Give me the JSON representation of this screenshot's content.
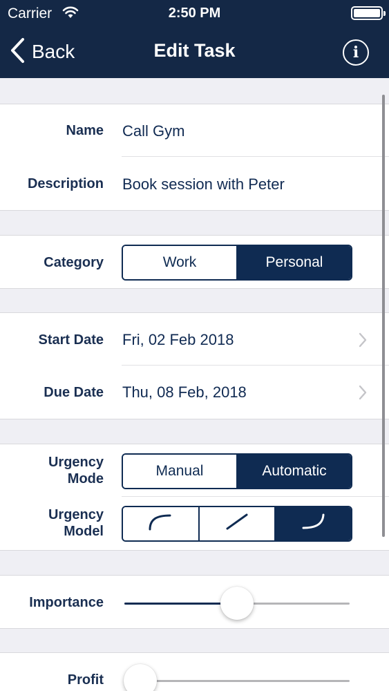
{
  "status_bar": {
    "carrier": "Carrier",
    "time": "2:50 PM"
  },
  "nav": {
    "back_label": "Back",
    "title": "Edit Task",
    "info_glyph": "i"
  },
  "task": {
    "name_label": "Name",
    "name_value": "Call Gym",
    "description_label": "Description",
    "description_value": "Book session with Peter"
  },
  "category": {
    "label": "Category",
    "options": [
      "Work",
      "Personal"
    ],
    "selected": "Personal"
  },
  "dates": {
    "start_label": "Start Date",
    "start_value": "Fri, 02 Feb 2018",
    "due_label": "Due Date",
    "due_value": "Thu, 08 Feb, 2018"
  },
  "urgency": {
    "mode_label_line1": "Urgency",
    "mode_label_line2": "Mode",
    "mode_options": [
      "Manual",
      "Automatic"
    ],
    "mode_selected": "Automatic",
    "model_label_line1": "Urgency",
    "model_label_line2": "Model",
    "model_options_icons": [
      "curve-concave-icon",
      "curve-linear-icon",
      "curve-convex-icon"
    ],
    "model_selected_index": 2
  },
  "importance": {
    "label": "Importance",
    "value": 0.5
  },
  "profit": {
    "label": "Profit",
    "value": 0.07
  },
  "colors": {
    "navbar": "#142846",
    "accent": "#0f2b52",
    "background": "#efeff4"
  }
}
